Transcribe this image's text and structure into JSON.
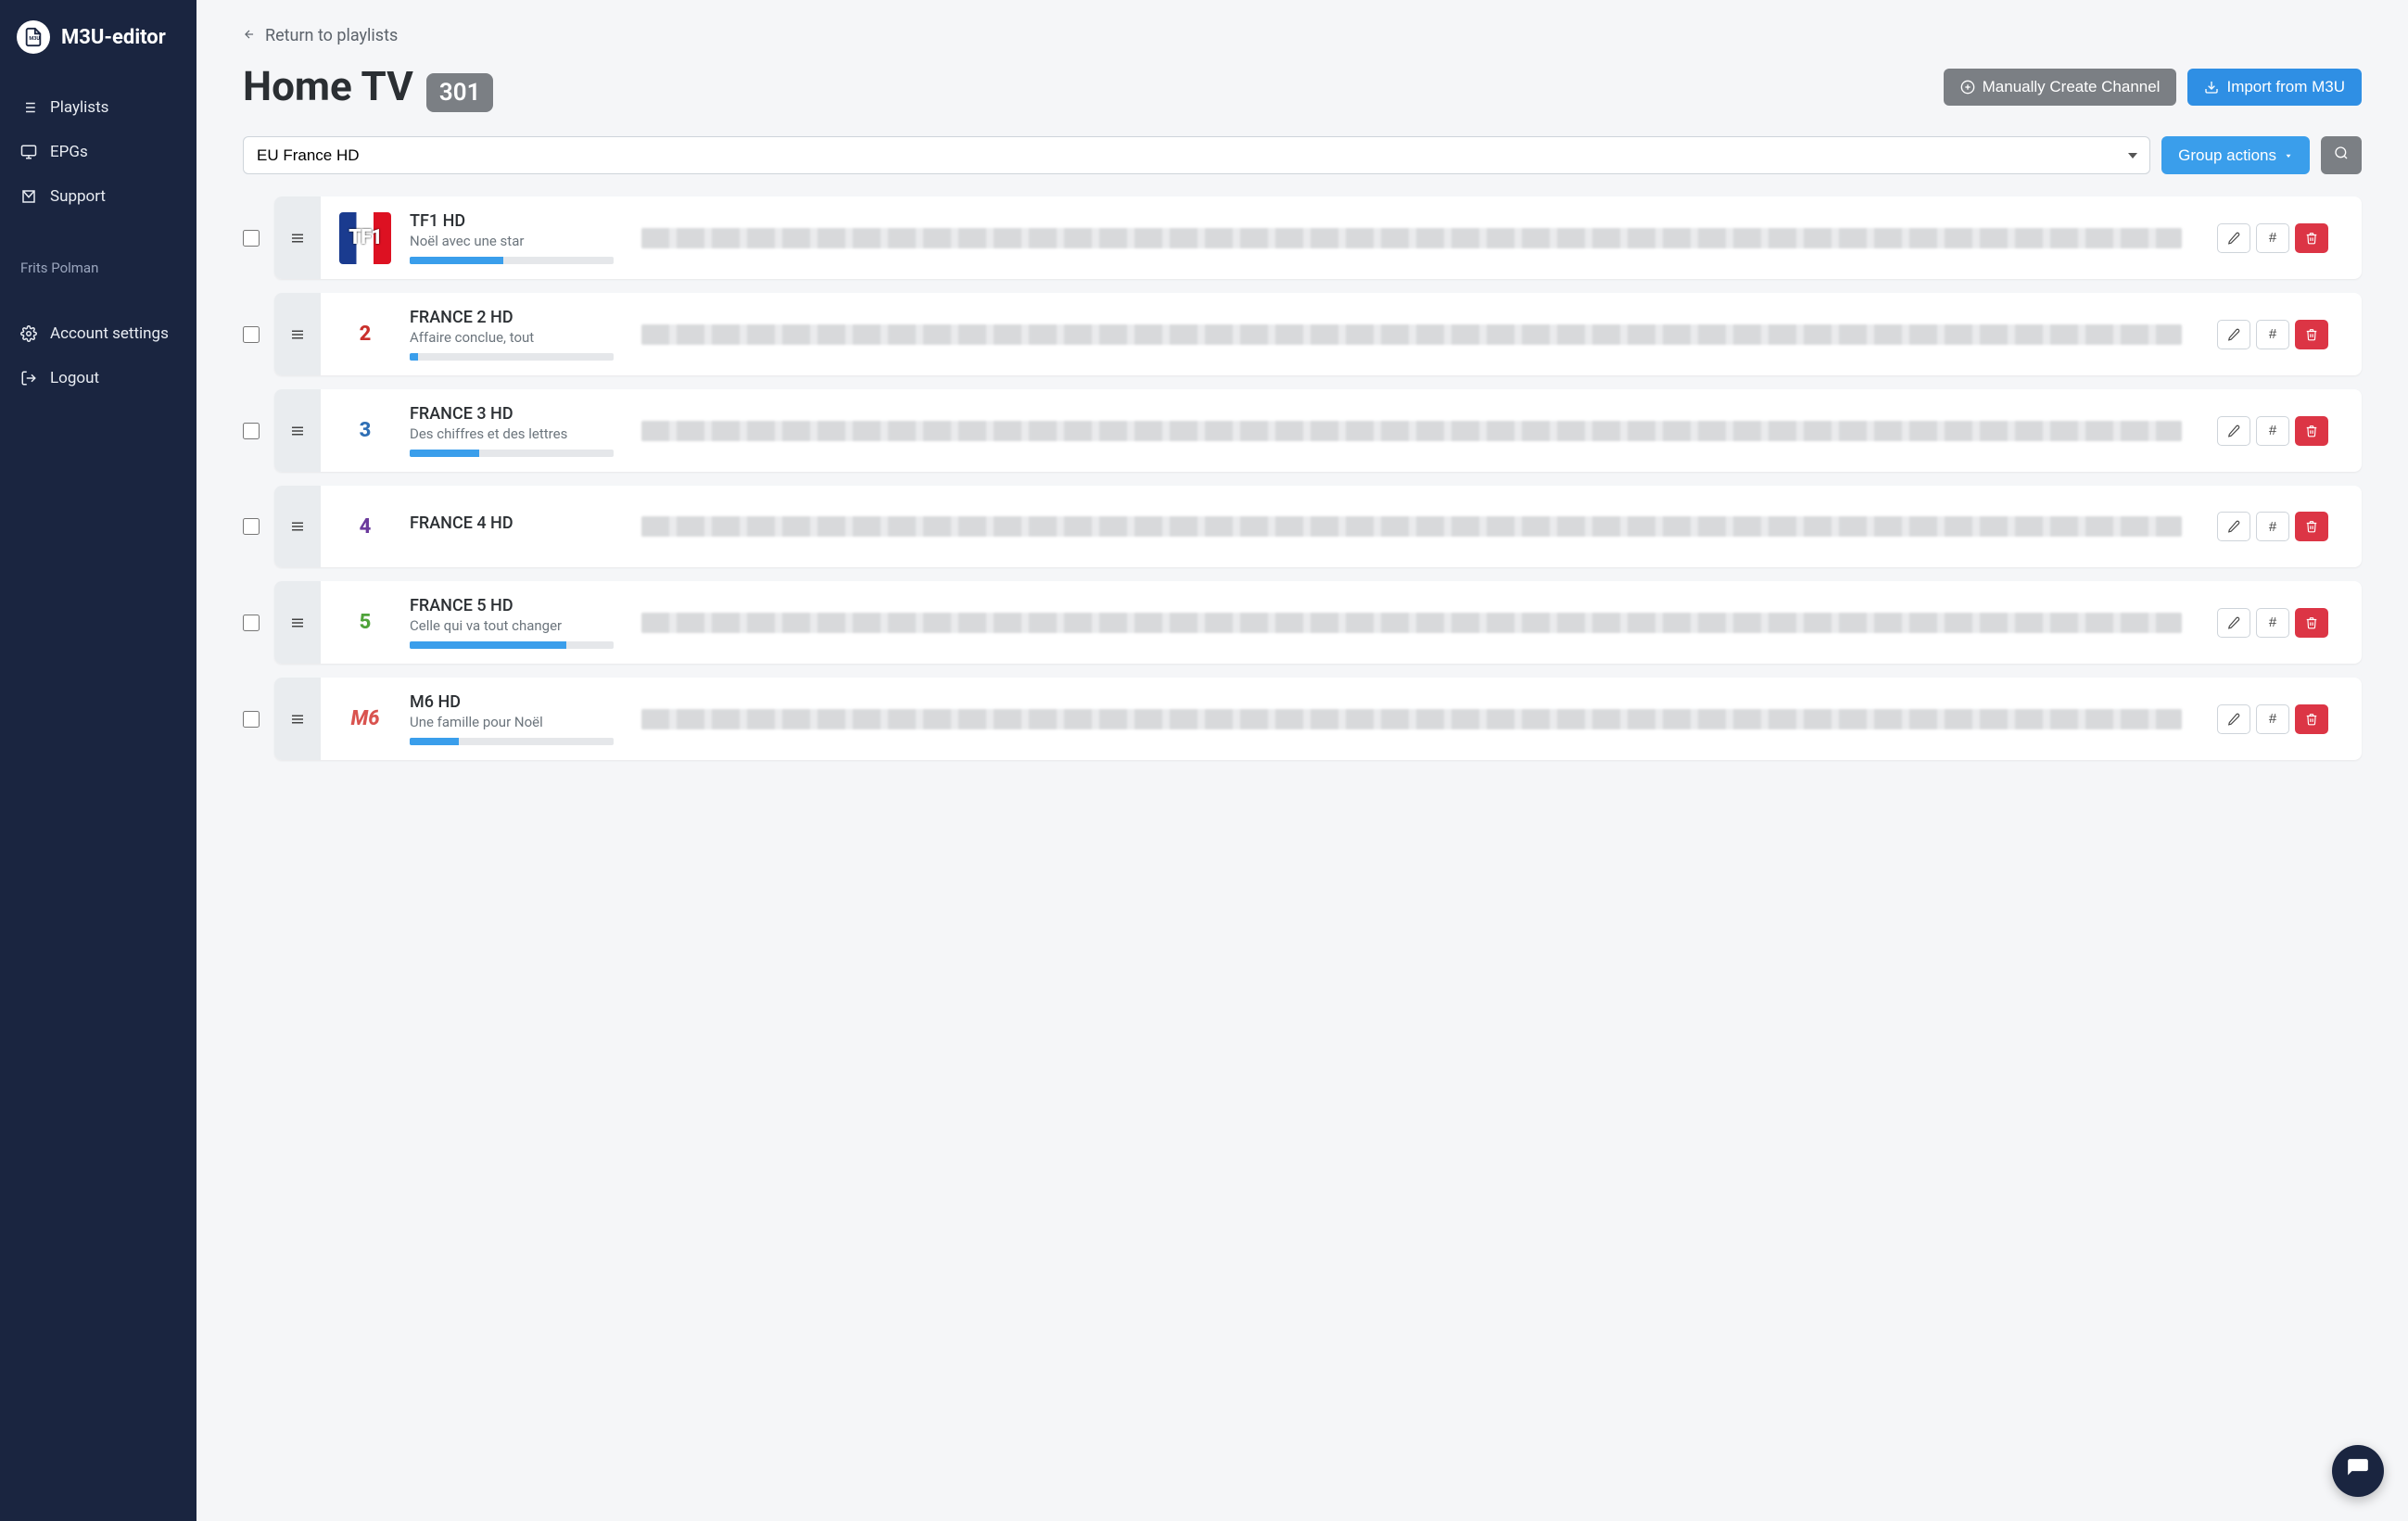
{
  "brand": {
    "name": "M3U-editor"
  },
  "sidebar": {
    "items": [
      {
        "label": "Playlists",
        "icon": "list"
      },
      {
        "label": "EPGs",
        "icon": "monitor"
      },
      {
        "label": "Support",
        "icon": "mail"
      }
    ],
    "user_name": "Frits Polman",
    "account": [
      {
        "label": "Account settings",
        "icon": "gear"
      },
      {
        "label": "Logout",
        "icon": "logout"
      }
    ]
  },
  "back_link": "Return to playlists",
  "title": "Home TV",
  "count_badge": "301",
  "buttons": {
    "create_channel": "Manually Create Channel",
    "import": "Import from M3U",
    "group_actions": "Group actions"
  },
  "filter": {
    "selected": "EU France HD"
  },
  "channels": [
    {
      "name": "TF1 HD",
      "subtitle": "Noël avec une star",
      "progress": 46,
      "logo": "tf1",
      "logo_text": "TF1"
    },
    {
      "name": "FRANCE 2 HD",
      "subtitle": "Affaire conclue, tout",
      "progress": 4,
      "logo": "f2",
      "logo_text": "2"
    },
    {
      "name": "FRANCE 3 HD",
      "subtitle": "Des chiffres et des lettres",
      "progress": 34,
      "logo": "f3",
      "logo_text": "3"
    },
    {
      "name": "FRANCE 4 HD",
      "subtitle": "",
      "progress": 0,
      "logo": "f4",
      "logo_text": "4"
    },
    {
      "name": "FRANCE 5 HD",
      "subtitle": "Celle qui va tout changer",
      "progress": 77,
      "logo": "f5",
      "logo_text": "5"
    },
    {
      "name": "M6 HD",
      "subtitle": "Une famille pour Noël",
      "progress": 24,
      "logo": "m6",
      "logo_text": "M6"
    }
  ]
}
